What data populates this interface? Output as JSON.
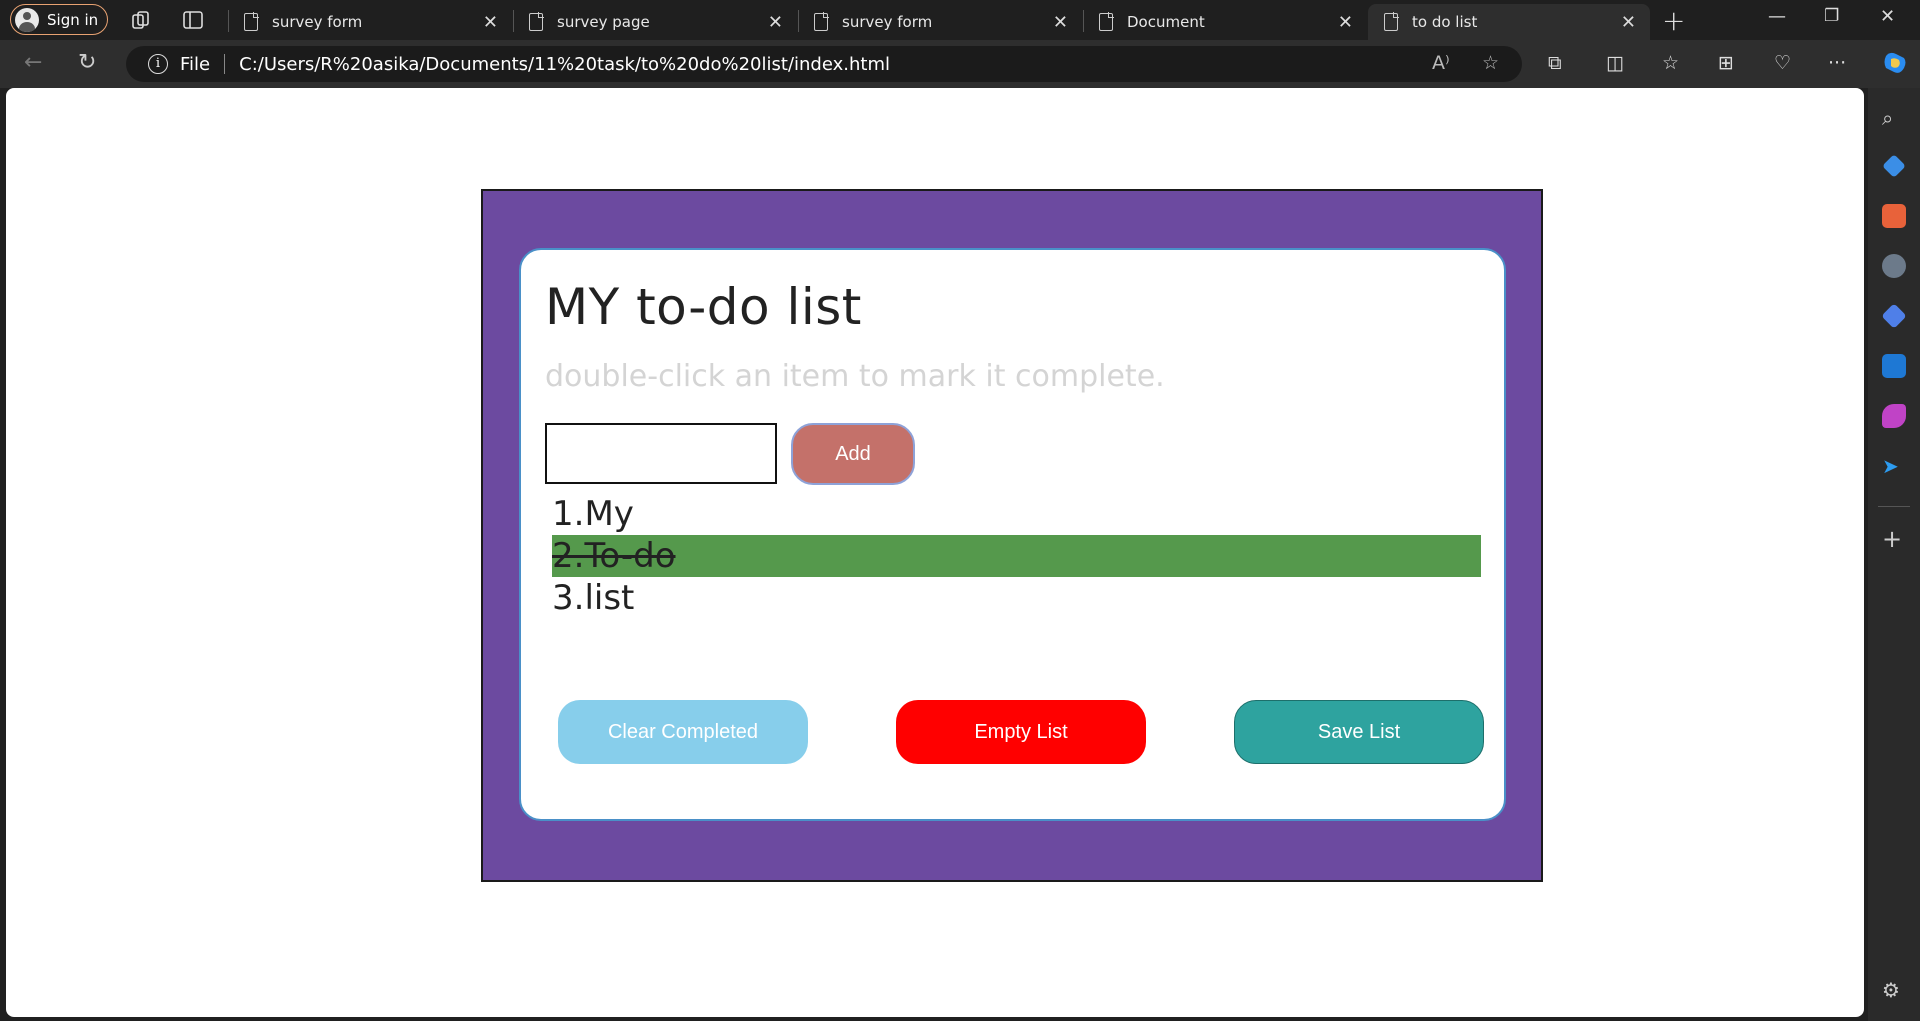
{
  "browser": {
    "signin_label": "Sign in",
    "tabs": [
      {
        "title": "survey form"
      },
      {
        "title": "survey page"
      },
      {
        "title": "survey form"
      },
      {
        "title": "Document"
      },
      {
        "title": "to do list"
      }
    ],
    "address": {
      "scheme_label": "File",
      "url": "C:/Users/R%20asika/Documents/11%20task/to%20do%20list/index.html"
    }
  },
  "page": {
    "title": "MY to-do list",
    "hint": "double-click an item to mark it complete.",
    "input": {
      "value": "",
      "placeholder": ""
    },
    "add_label": "Add",
    "items": [
      {
        "text": "1.My",
        "completed": false
      },
      {
        "text": "2.To-do",
        "completed": true
      },
      {
        "text": "3.list",
        "completed": false
      }
    ],
    "buttons": {
      "clear_completed": "Clear Completed",
      "empty_list": "Empty List",
      "save_list": "Save List"
    }
  },
  "colors": {
    "frame": "#6c4aa0",
    "add_button": "#c4716a",
    "completed_item": "#55994c",
    "clear_button": "#87ceeb",
    "empty_button": "#ff0000",
    "save_button": "#2ea39f"
  }
}
